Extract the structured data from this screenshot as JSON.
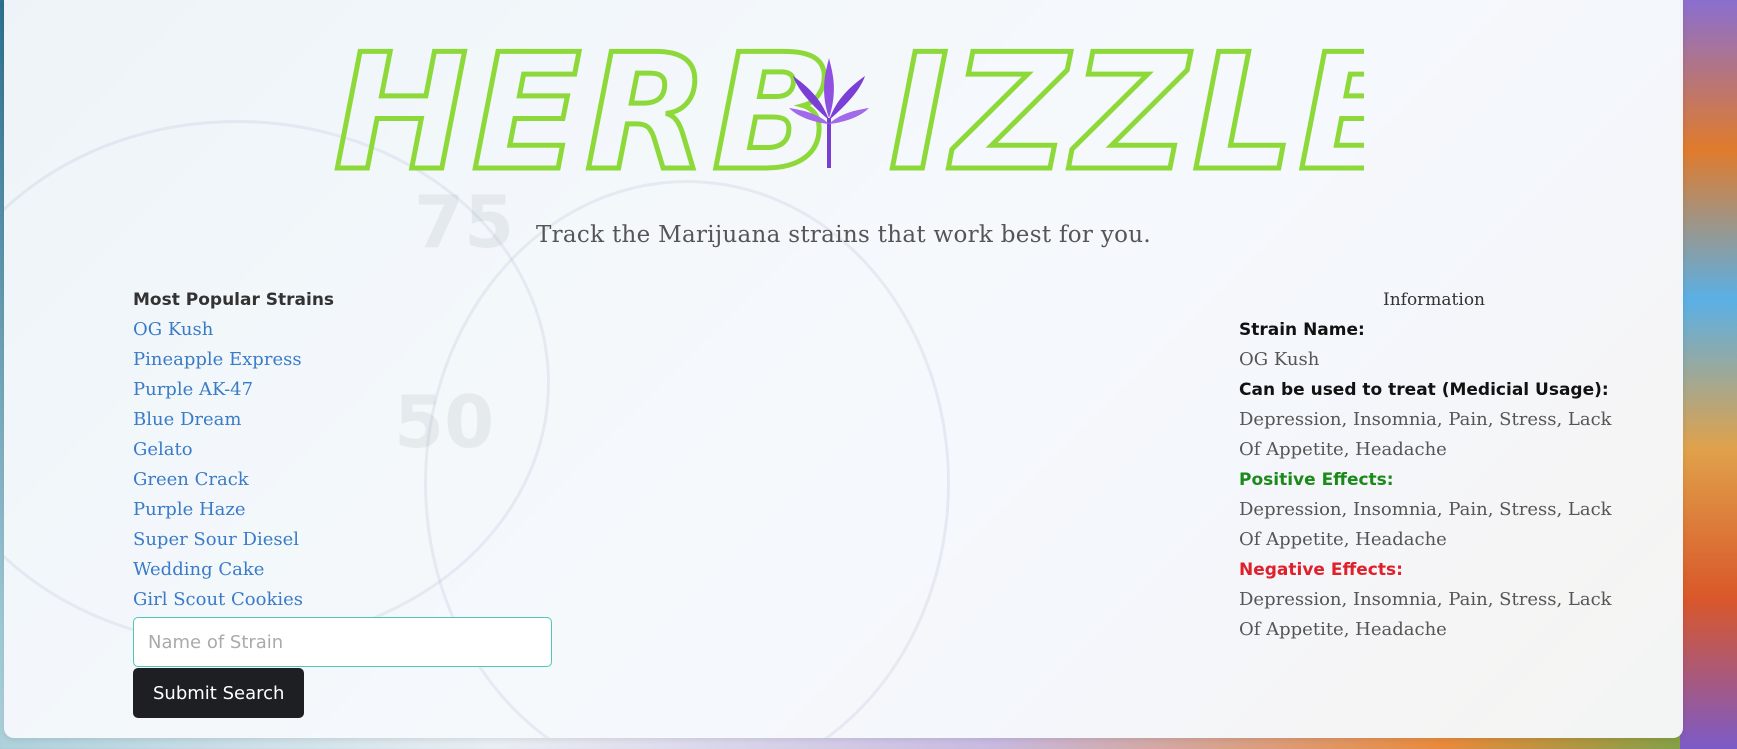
{
  "brand": {
    "logo_text_left": "HERB",
    "logo_text_right": "IZZLE",
    "outline_color": "#8ed93a",
    "leaf_color": "#8f4fe0"
  },
  "tagline": "Track the Marijuana strains that work best for you.",
  "popular": {
    "heading": "Most Popular Strains",
    "strains": [
      "OG Kush",
      "Pineapple Express",
      "Purple AK-47",
      "Blue Dream",
      "Gelato",
      "Green Crack",
      "Purple Haze",
      "Super Sour Diesel",
      "Wedding Cake",
      "Girl Scout Cookies"
    ]
  },
  "search": {
    "placeholder": "Name of Strain",
    "value": "",
    "submit_label": "Submit Search"
  },
  "info": {
    "heading": "Information",
    "strain_name_label": "Strain Name:",
    "strain_name": "OG Kush",
    "medical_label": "Can be used to treat (Medicial Usage):",
    "medical_value": "Depression, Insomnia, Pain, Stress, Lack Of Appetite, Headache",
    "positive_label": "Positive Effects:",
    "positive_value": "Depression, Insomnia, Pain, Stress, Lack Of Appetite, Headache",
    "negative_label": "Negative Effects:",
    "negative_value": "Depression, Insomnia, Pain, Stress, Lack Of Appetite, Headache"
  },
  "colors": {
    "link": "#3a7bc8",
    "positive": "#1b8a1b",
    "negative": "#e0202a",
    "input_border": "#4fc6b6",
    "button_bg": "#1e1f22"
  }
}
